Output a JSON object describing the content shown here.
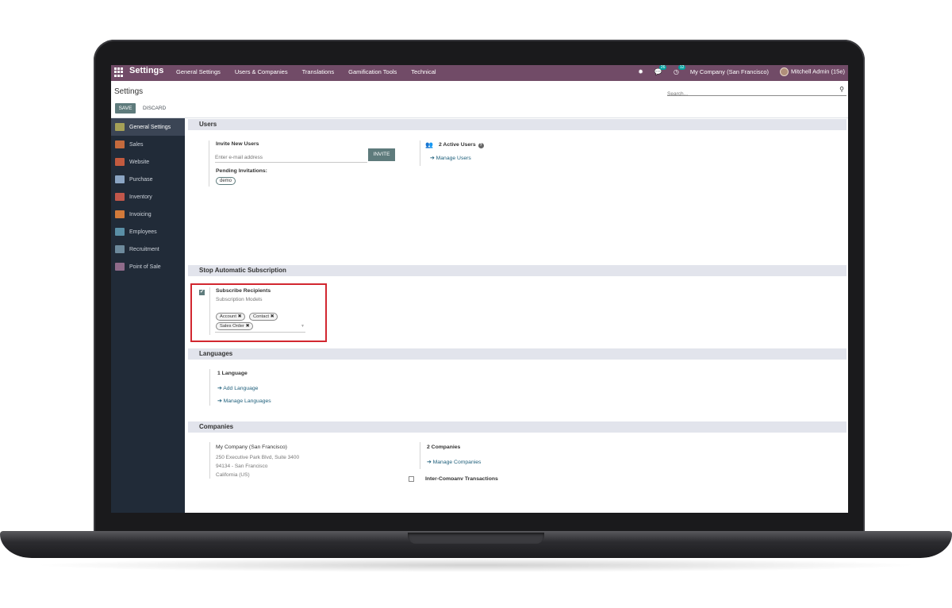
{
  "navbar": {
    "brand": "Settings",
    "menu": [
      "General Settings",
      "Users & Companies",
      "Translations",
      "Gamification Tools",
      "Technical"
    ],
    "messages_count": "26",
    "activity_count": "12",
    "company": "My Company (San Francisco)",
    "user": "Mitchell Admin (15e)"
  },
  "control_panel": {
    "title": "Settings",
    "save_label": "SAVE",
    "discard_label": "DISCARD",
    "search_placeholder": "Search..."
  },
  "sidebar": {
    "items": [
      {
        "label": "General Settings",
        "color": "#a4a057"
      },
      {
        "label": "Sales",
        "color": "#c46a3d"
      },
      {
        "label": "Website",
        "color": "#c25a3f"
      },
      {
        "label": "Purchase",
        "color": "#8ba5c4"
      },
      {
        "label": "Inventory",
        "color": "#c1574b"
      },
      {
        "label": "Invoicing",
        "color": "#d27a3a"
      },
      {
        "label": "Employees",
        "color": "#5a8fa6"
      },
      {
        "label": "Recruitment",
        "color": "#6d8a9c"
      },
      {
        "label": "Point of Sale",
        "color": "#8f6b8a"
      }
    ]
  },
  "users": {
    "heading": "Users",
    "invite_label": "Invite New Users",
    "email_placeholder": "Enter e-mail address",
    "invite_button": "INVITE",
    "pending_label": "Pending Invitations:",
    "pending_items": [
      "demo"
    ],
    "active_users": "2 Active Users",
    "manage_users": "Manage Users"
  },
  "subscription": {
    "heading": "Stop Automatic Subscription",
    "option_label": "Subscribe Recipients",
    "option_sub": "Subscription Models",
    "tags": [
      "Account",
      "Contact",
      "Sales Order"
    ]
  },
  "languages": {
    "heading": "Languages",
    "count": "1 Language",
    "add": "Add Language",
    "manage": "Manage Languages"
  },
  "companies": {
    "heading": "Companies",
    "name": "My Company (San Francisco)",
    "address1": "250 Executive Park Blvd, Suite 3400",
    "address2": "94134 - San Francisco",
    "address3": "California (US)",
    "count": "2 Companies",
    "manage": "Manage Companies",
    "inter_company": "Inter-Company Transactions"
  },
  "colors": {
    "navbar": "#714b67",
    "sidebar": "#212b38",
    "primary_button": "#5e7b7c",
    "highlight_box": "#d22730"
  }
}
